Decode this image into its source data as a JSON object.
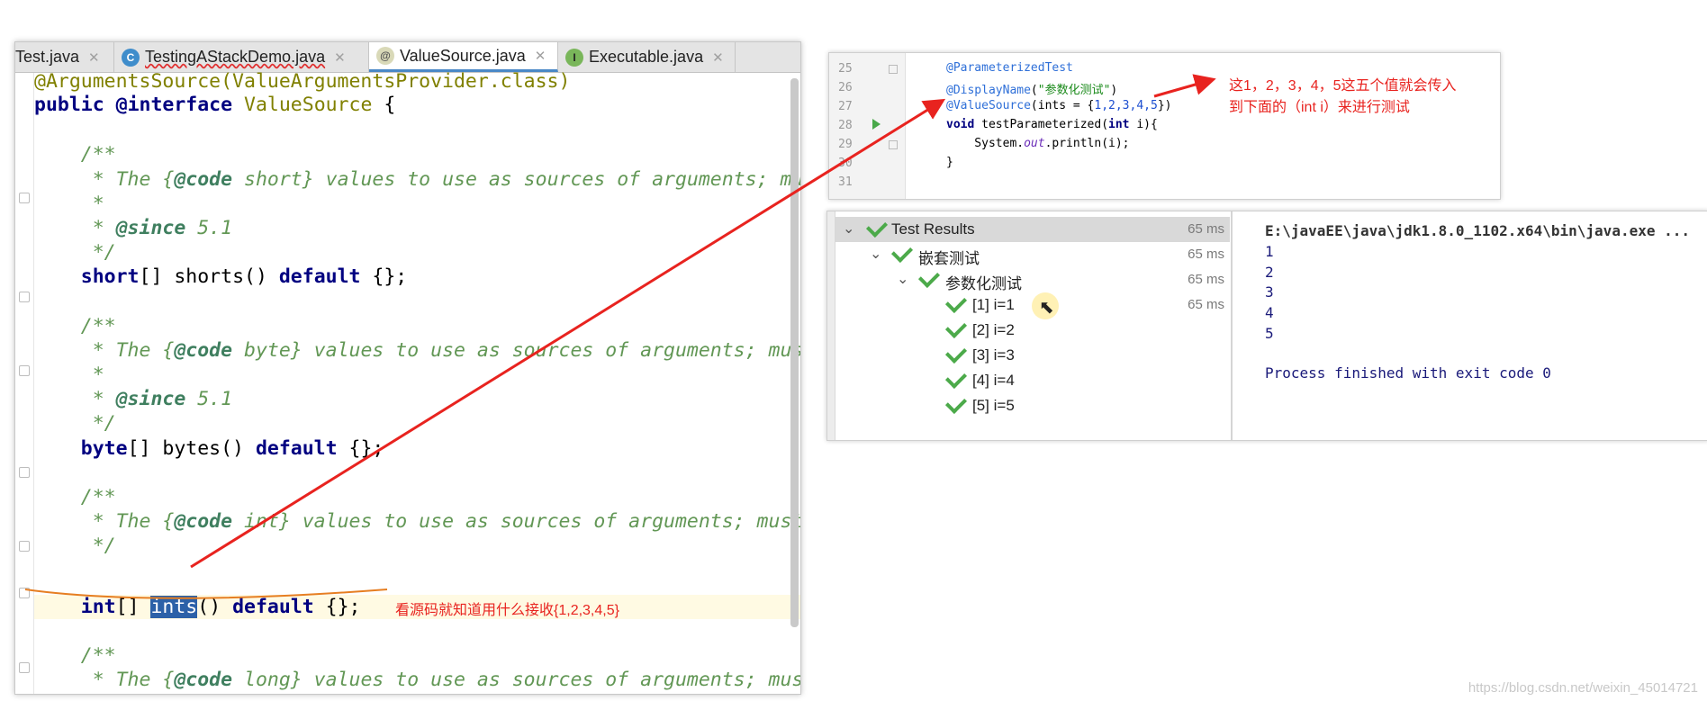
{
  "editor": {
    "tabs": [
      {
        "label": "Test.java",
        "icon": "java-class-icon"
      },
      {
        "label": "TestingAStackDemo.java",
        "icon": "class-c-icon"
      },
      {
        "label": "ValueSource.java",
        "icon": "annotation-icon"
      },
      {
        "label": "Executable.java",
        "icon": "interface-icon"
      }
    ],
    "code": {
      "l0": "@ArgumentsSource(ValueArgumentsProvider.class)",
      "l1_kw1": "public",
      "l1_kw2": "@interface",
      "l1_name": "ValueSource",
      "l1_brace": " {",
      "c1_open": "    /**",
      "c1_pre": "     * The {",
      "c1_tag": "@code",
      "c1_post": " short} values to use as sources of arguments; mu",
      "star": "     *",
      "since_pre": "     * ",
      "since_tag": "@since",
      "since_val": " 5.1",
      "c_close": "     */",
      "m1_type": "short",
      "m1_rest": "[] shorts() ",
      "default_kw": "default",
      "m_end": " {};",
      "c2_post": " byte} values to use as sources of arguments; mus",
      "m2_type": "byte",
      "m2_rest": "[] bytes() ",
      "c3_post": " int} values to use as sources of arguments; must",
      "m3_type": "int",
      "m3_mid": "[] ",
      "m3_sel": "ints",
      "m3_rest": "() ",
      "c4_post": " long} values to use as sources of arguments; mus"
    },
    "note": "看源码就知道用什么接收{1,2,3,4,5}"
  },
  "snippet": {
    "line_numbers": [
      "25",
      "26",
      "27",
      "28",
      "29",
      "30",
      "31"
    ],
    "l25": "@ParameterizedTest",
    "l26_a": "@DisplayName",
    "l26_b": "(",
    "l26_s": "\"参数化测试\"",
    "l26_c": ")",
    "l27_a": "@ValueSource",
    "l27_b": "(ints = {",
    "l27_n": "1,2,3,4,5",
    "l27_c": "})",
    "l28_kw": "void",
    "l28_rest": " testParameterized(",
    "l28_kw2": "int",
    "l28_end": " i){",
    "l29_a": "    System.",
    "l29_out": "out",
    "l29_b": ".println(i);",
    "l30": "}",
    "note_line1": "这1，2，3，4，5这五个值就会传入",
    "note_line2": "到下面的（int i）来进行测试"
  },
  "test_results": {
    "tree": [
      {
        "label": "Test Results",
        "time": "65 ms",
        "level": 0,
        "expanded": true
      },
      {
        "label": "嵌套测试",
        "time": "65 ms",
        "level": 1,
        "expanded": true
      },
      {
        "label": "参数化测试",
        "time": "65 ms",
        "level": 2,
        "expanded": true
      },
      {
        "label": "[1] i=1",
        "time": "65 ms",
        "level": 3
      },
      {
        "label": "[2] i=2",
        "time": "",
        "level": 3
      },
      {
        "label": "[3] i=3",
        "time": "",
        "level": 3
      },
      {
        "label": "[4] i=4",
        "time": "",
        "level": 3
      },
      {
        "label": "[5] i=5",
        "time": "",
        "level": 3
      }
    ],
    "console": {
      "command": "E:\\javaEE\\java\\jdk1.8.0_1102.x64\\bin\\java.exe ...",
      "outputs": [
        "1",
        "2",
        "3",
        "4",
        "5"
      ],
      "exit": "Process finished with exit code 0"
    }
  },
  "colors": {
    "annotation_red": "#e8231f",
    "check_green": "#4caa4a",
    "selection_blue": "#2c61a8"
  },
  "watermark": "https://blog.csdn.net/weixin_45014721"
}
